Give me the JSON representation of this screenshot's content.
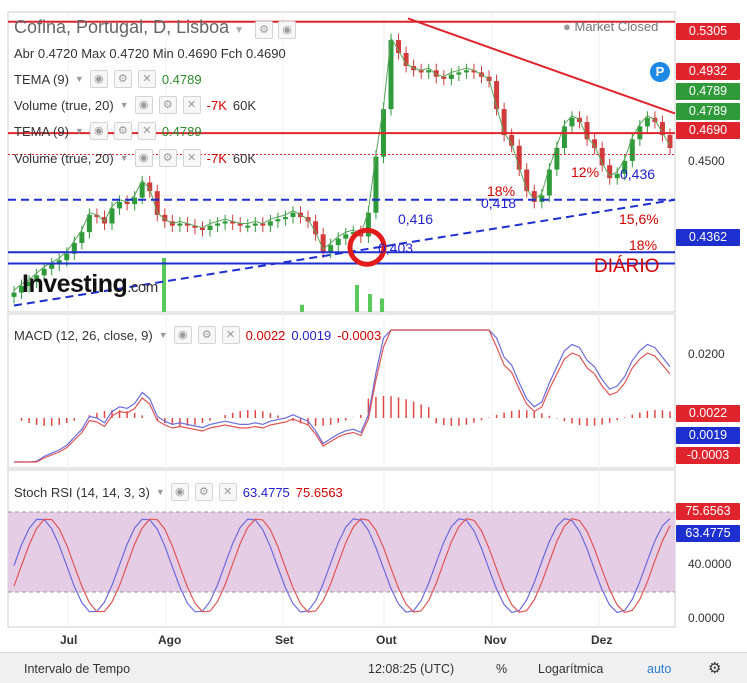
{
  "header": {
    "title": "Cofina, Portugal, D, Lisboa",
    "market_status": "Market Closed",
    "ohlc": "Abr 0.4720 Max 0.4720 Min 0.4690 Fch 0.4690"
  },
  "indicators": {
    "tema1": {
      "label": "TEMA (9)",
      "value": "0.4789"
    },
    "volume1": {
      "label": "Volume (true, 20)",
      "v1": "-7K",
      "v2": "60K"
    },
    "tema2": {
      "label": "TEMA (9)",
      "value": "0.4789"
    },
    "volume2": {
      "label": "Volume (true, 20)",
      "v1": "-7K",
      "v2": "60K"
    }
  },
  "macd": {
    "label": "MACD (12, 26, close, 9)",
    "v1": "0.0022",
    "v2": "0.0019",
    "v3": "-0.0003"
  },
  "stoch": {
    "label": "Stoch RSI (14, 14, 3, 3)",
    "v1": "63.4775",
    "v2": "75.6563"
  },
  "price_axis": {
    "tags": [
      {
        "text": "0.5305",
        "color": "#e0242d"
      },
      {
        "text": "0.4932",
        "color": "#e0242d"
      },
      {
        "text": "0.4789",
        "color": "#2f9a3a"
      },
      {
        "text": "0.4789",
        "color": "#2f9a3a"
      },
      {
        "text": "0.4690",
        "color": "#e0242d"
      },
      {
        "text": "0.4362",
        "color": "#1e2fcf"
      }
    ],
    "ticks": [
      "0.4500"
    ],
    "macd_ticks": [
      "0.0200"
    ],
    "macd_tags": [
      {
        "text": "0.0022",
        "color": "#e0242d"
      },
      {
        "text": "0.0019",
        "color": "#1e2fcf"
      },
      {
        "text": "-0.0003",
        "color": "#e0242d"
      }
    ],
    "stoch_ticks": [
      "40.0000",
      "0.0000"
    ],
    "stoch_tags": [
      {
        "text": "75.6563",
        "color": "#e0242d"
      },
      {
        "text": "63.4775",
        "color": "#1e2fcf"
      }
    ]
  },
  "annotations": {
    "a18top": "18%",
    "a12": "12%",
    "a436": "0,436",
    "a418": "0,418",
    "a416": "0,416",
    "a403": "0,403",
    "a156": "15,6%",
    "a18b": "18%",
    "diario": "DIÁRIO",
    "p_badge": "P"
  },
  "logo": {
    "main": "Investing",
    "suffix": ".com"
  },
  "x_axis": [
    "Jul",
    "Ago",
    "Set",
    "Out",
    "Nov",
    "Dez"
  ],
  "bottom_bar": {
    "time_range": "Intervalo de Tempo",
    "clock": "12:08:25 (UTC)",
    "percent": "%",
    "log": "Logarítmica",
    "auto": "auto"
  },
  "colors": {
    "up": "#2f9a3a",
    "down": "#d23b3b",
    "trend": "#e0242d",
    "support": "#1e2fcf",
    "stoch_band": "#e6cde6"
  },
  "chart_data": {
    "type": "candlestick",
    "title": "Cofina, Portugal, D, Lisboa",
    "x": [
      "Jul",
      "Ago",
      "Set",
      "Out",
      "Nov",
      "Dez"
    ],
    "price_range": [
      0.396,
      0.535
    ],
    "close_series": [
      0.405,
      0.408,
      0.41,
      0.413,
      0.416,
      0.418,
      0.42,
      0.423,
      0.428,
      0.433,
      0.441,
      0.44,
      0.437,
      0.444,
      0.447,
      0.446,
      0.449,
      0.456,
      0.452,
      0.441,
      0.438,
      0.436,
      0.437,
      0.436,
      0.435,
      0.434,
      0.436,
      0.437,
      0.438,
      0.437,
      0.436,
      0.436,
      0.437,
      0.436,
      0.438,
      0.439,
      0.44,
      0.442,
      0.44,
      0.438,
      0.432,
      0.424,
      0.427,
      0.43,
      0.432,
      0.433,
      0.431,
      0.442,
      0.468,
      0.49,
      0.522,
      0.516,
      0.51,
      0.508,
      0.507,
      0.508,
      0.505,
      0.504,
      0.506,
      0.507,
      0.508,
      0.507,
      0.505,
      0.503,
      0.49,
      0.478,
      0.473,
      0.462,
      0.452,
      0.447,
      0.45,
      0.462,
      0.472,
      0.482,
      0.486,
      0.484,
      0.476,
      0.472,
      0.464,
      0.458,
      0.46,
      0.466,
      0.476,
      0.482,
      0.486,
      0.484,
      0.478,
      0.472
    ],
    "levels": {
      "resistance": 0.5305,
      "horizontal": 0.4789,
      "support_1": 0.418,
      "support_2": 0.4362
    }
  }
}
